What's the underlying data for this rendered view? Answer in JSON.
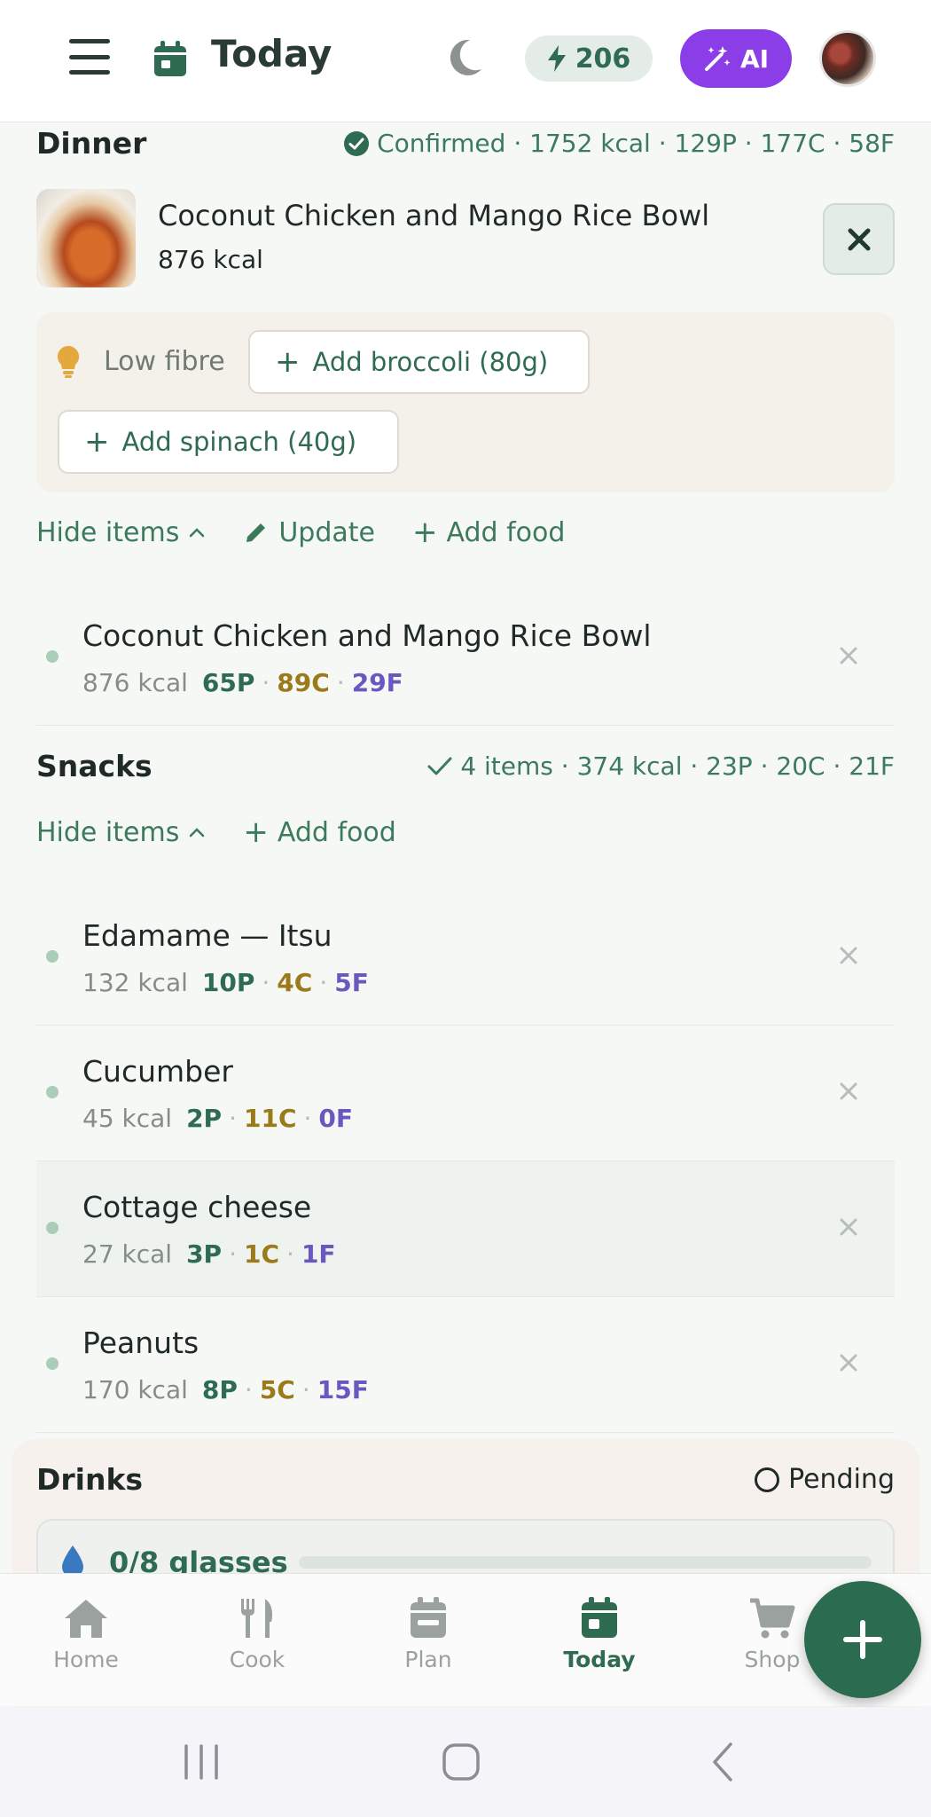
{
  "header": {
    "title": "Today",
    "energy_count": "206",
    "ai_label": "AI",
    "icons": [
      "menu-icon",
      "calendar-icon",
      "moon-icon",
      "bolt-icon",
      "magic-wand-icon"
    ]
  },
  "dinner": {
    "title": "Dinner",
    "status": "Confirmed · 1752 kcal · 129P · 177C · 58F",
    "meal": {
      "name": "Coconut Chicken and Mango Rice Bowl",
      "kcal": "876 kcal"
    },
    "suggestion": {
      "label": "Low fibre",
      "chips": [
        "Add broccoli (80g)",
        "Add spinach (40g)"
      ]
    },
    "actions": {
      "hide": "Hide items",
      "update": "Update",
      "add": "Add food"
    },
    "items": [
      {
        "name": "Coconut Chicken and Mango Rice Bowl",
        "kcal": "876 kcal",
        "p": "65P",
        "c": "89C",
        "f": "29F"
      }
    ]
  },
  "snacks": {
    "title": "Snacks",
    "status": "4 items · 374 kcal · 23P · 20C · 21F",
    "actions": {
      "hide": "Hide items",
      "add": "Add food"
    },
    "items": [
      {
        "name": "Edamame — Itsu",
        "kcal": "132 kcal",
        "p": "10P",
        "c": "4C",
        "f": "5F"
      },
      {
        "name": "Cucumber",
        "kcal": "45 kcal",
        "p": "2P",
        "c": "11C",
        "f": "0F"
      },
      {
        "name": "Cottage cheese",
        "kcal": "27 kcal",
        "p": "3P",
        "c": "1C",
        "f": "1F"
      },
      {
        "name": "Peanuts",
        "kcal": "170 kcal",
        "p": "8P",
        "c": "5C",
        "f": "15F"
      }
    ]
  },
  "drinks": {
    "title": "Drinks",
    "status": "Pending",
    "glasses": "0/8 glasses",
    "progress": 0
  },
  "nav": {
    "items": [
      "Home",
      "Cook",
      "Plan",
      "Today",
      "Shop"
    ],
    "active": "Today"
  },
  "colors": {
    "brand_green": "#2f6b50",
    "ai_purple": "#8b3ee8",
    "protein": "#2f6b50",
    "carbs": "#9b7a1a",
    "fat": "#6a58c0"
  }
}
